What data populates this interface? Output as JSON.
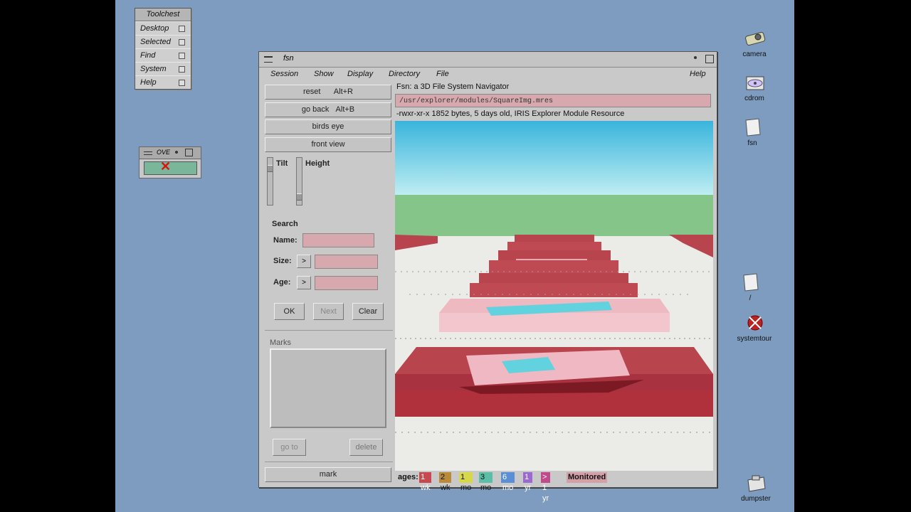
{
  "toolchest": {
    "title": "Toolchest",
    "items": [
      "Desktop",
      "Selected",
      "Find",
      "System",
      "Help"
    ]
  },
  "overview_widget": {
    "title": "OVE"
  },
  "window": {
    "title": "fsn",
    "menus": [
      "Session",
      "Show",
      "Display",
      "Directory",
      "File"
    ],
    "help": "Help"
  },
  "left_panel": {
    "buttons": [
      {
        "label": "reset",
        "shortcut": "Alt+R"
      },
      {
        "label": "go back",
        "shortcut": "Alt+B"
      },
      {
        "label": "birds eye",
        "shortcut": ""
      },
      {
        "label": "front view",
        "shortcut": ""
      }
    ],
    "tilt_label": "Tilt",
    "height_label": "Height",
    "search": {
      "heading": "Search",
      "name_label": "Name:",
      "size_label": "Size:",
      "age_label": "Age:",
      "size_op": ">",
      "age_op": ">",
      "ok": "OK",
      "next": "Next",
      "clear": "Clear"
    },
    "marks": {
      "heading": "Marks",
      "goto": "go to",
      "delete": "delete",
      "mark": "mark"
    }
  },
  "right_panel": {
    "title": "Fsn:   a 3D File System Navigator",
    "path": "/usr/explorer/modules/SquareImg.mres",
    "file_info": "-rwxr-xr-x   1852 bytes, 5 days old, IRIS Explorer Module Resource",
    "ages_label": "ages:",
    "ages": [
      {
        "label": "1 wk",
        "color": "#c8484f"
      },
      {
        "label": "2 wk",
        "color": "#b88a3a"
      },
      {
        "label": "1 mo",
        "color": "#d6d84a"
      },
      {
        "label": "3 mo",
        "color": "#5bbfa8"
      },
      {
        "label": "6 mo",
        "color": "#5a8fd6"
      },
      {
        "label": "1 yr",
        "color": "#9a6ad0"
      },
      {
        "label": "> 1 yr",
        "color": "#c04a8a"
      }
    ],
    "monitored": "Monitored",
    "monitored_color": "#d4a0a8"
  },
  "desktop_icons": [
    {
      "label": "camera",
      "icon": "camera-icon"
    },
    {
      "label": "cdrom",
      "icon": "cdrom-icon"
    },
    {
      "label": "fsn",
      "icon": "fsn-file-icon"
    },
    {
      "label": "/",
      "icon": "root-folder-icon"
    },
    {
      "label": "systemtour",
      "icon": "systemtour-icon"
    },
    {
      "label": "dumpster",
      "icon": "dumpster-icon"
    }
  ]
}
